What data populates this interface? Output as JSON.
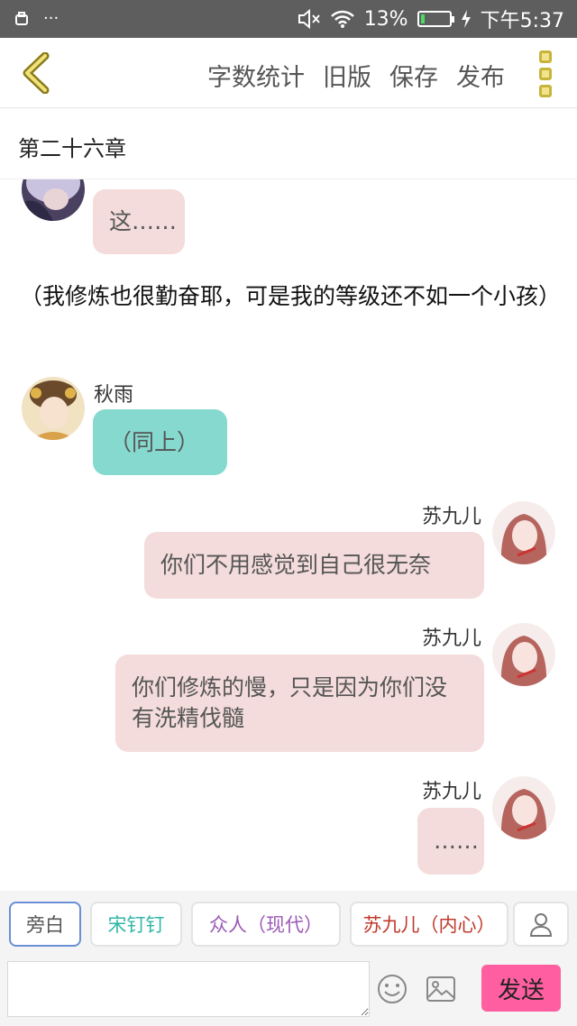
{
  "status_bar": {
    "left_icons": [
      "notification-icon",
      "more-dots-icon"
    ],
    "mute_icon": "mute-icon",
    "wifi_icon": "wifi-icon",
    "battery_percent": "13%",
    "battery_level": 0.13,
    "charging_icon": "charging-icon",
    "time": "下午5:37"
  },
  "toolbar": {
    "back_icon": "chevron-left-icon",
    "word_count_label": "字数统计",
    "old_version_label": "旧版",
    "save_label": "保存",
    "publish_label": "发布",
    "more_icon": "more-vertical-icon",
    "accent": "#c8b43a"
  },
  "chapter": {
    "title": "第二十六章"
  },
  "messages": [
    {
      "side": "left",
      "name": "",
      "text": "这……",
      "color": "#f3dcdb"
    },
    {
      "type": "narration",
      "text": "（我修炼也很勤奋耶，可是我的等级还不如一个小孩）"
    },
    {
      "side": "left",
      "name": "秋雨",
      "text": "（同上）",
      "color": "#86d9cf"
    },
    {
      "side": "right",
      "name": "苏九儿",
      "text": "你们不用感觉到自己很无奈",
      "color": "#f3dcdb"
    },
    {
      "side": "right",
      "name": "苏九儿",
      "text": "你们修炼的慢，只是因为你们没有洗精伐髓",
      "color": "#f3dcdb"
    },
    {
      "side": "right",
      "name": "苏九儿",
      "text": "……",
      "color": "#f3dcdb"
    }
  ],
  "roles": [
    {
      "label": "旁白",
      "color": "#555555",
      "selected": true
    },
    {
      "label": "宋钉钉",
      "color": "#2fb6a6",
      "selected": false
    },
    {
      "label": "众人（现代）",
      "color": "#9b59b6",
      "selected": false
    },
    {
      "label": "苏九儿（内心）",
      "color": "#c0392b",
      "selected": false
    }
  ],
  "role_add_icon": "user-icon",
  "input": {
    "value": "",
    "placeholder": ""
  },
  "emoji_icon": "smiley-icon",
  "image_icon": "image-icon",
  "send_label": "发送",
  "send_color": "#ff5fa0"
}
